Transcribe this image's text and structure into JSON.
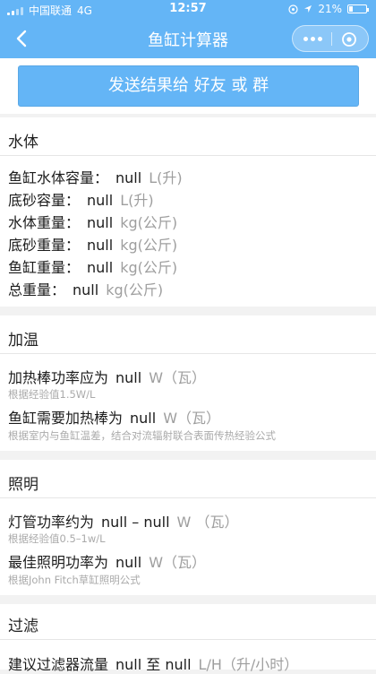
{
  "status_bar": {
    "carrier": "中国联通",
    "network": "4G",
    "time": "12:57",
    "battery": "21%",
    "battery_level": 0.21
  },
  "nav": {
    "title": "鱼缸计算器"
  },
  "share_button": "发送结果给 好友 或 群",
  "sections": {
    "water": {
      "title": "水体",
      "rows": [
        {
          "label": "鱼缸水体容量：",
          "value": "null",
          "unit": "L(升)"
        },
        {
          "label": "底砂容量：",
          "value": "null",
          "unit": "L(升)"
        },
        {
          "label": "水体重量：",
          "value": "null",
          "unit": "kg(公斤)"
        },
        {
          "label": "底砂重量：",
          "value": "null",
          "unit": "kg(公斤)"
        },
        {
          "label": "鱼缸重量：",
          "value": "null",
          "unit": "kg(公斤)"
        },
        {
          "label": "总重量：",
          "value": "null",
          "unit": "kg(公斤)"
        }
      ]
    },
    "heating": {
      "title": "加温",
      "rows": [
        {
          "label": "加热棒功率应为",
          "value": "null",
          "unit": "W（瓦）",
          "note": "根据经验值1.5W/L"
        },
        {
          "label": "鱼缸需要加热棒为",
          "value": "null",
          "unit": "W（瓦）",
          "note": "根据室内与鱼缸温差，结合对流辐射联合表面传热经验公式"
        }
      ]
    },
    "lighting": {
      "title": "照明",
      "rows": [
        {
          "label": "灯管功率约为",
          "value": "null – null",
          "unit": "W （瓦）",
          "note": "根据经验值0.5–1w/L"
        },
        {
          "label": "最佳照明功率为",
          "value": "null",
          "unit": "W（瓦）",
          "note": "根据John Fitch草缸照明公式"
        }
      ]
    },
    "filter": {
      "title": "过滤",
      "rows": [
        {
          "label": "建议过滤器流量",
          "value": "null 至 null",
          "unit": "L/H（升/小时）"
        }
      ]
    }
  }
}
